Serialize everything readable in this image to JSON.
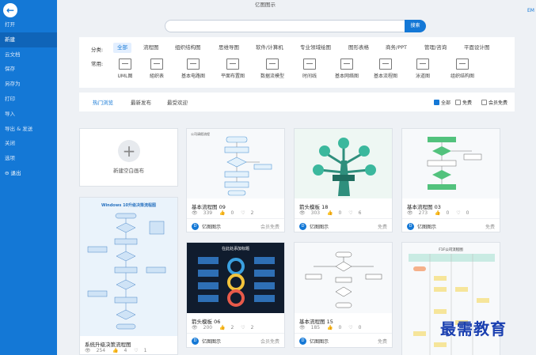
{
  "app": {
    "title": "亿图图示",
    "corner_text": "EM"
  },
  "sidebar": {
    "items": [
      {
        "label": "打开"
      },
      {
        "label": "新建"
      },
      {
        "label": "云文档"
      },
      {
        "label": "保存"
      },
      {
        "label": "另存为"
      },
      {
        "label": "打印"
      },
      {
        "label": "导入"
      },
      {
        "label": "导出 & 发送"
      },
      {
        "label": "关闭"
      },
      {
        "label": "选项"
      },
      {
        "label": "退出"
      }
    ]
  },
  "search": {
    "value": "",
    "button": "搜索"
  },
  "categories": {
    "label": "分类:",
    "items": [
      "全部",
      "流程图",
      "组织结构图",
      "思维导图",
      "软件/计算机",
      "专业领域绘图",
      "图形表格",
      "商务/PPT",
      "管理/咨询",
      "平面设计图"
    ]
  },
  "common": {
    "label": "常用:",
    "items": [
      "UML图",
      "組织表",
      "基本电路图",
      "平面布置图",
      "数据流模型",
      "时间线",
      "基本网络图",
      "基本流程图",
      "泳道图",
      "组织结构图"
    ]
  },
  "sort": {
    "tabs": [
      "热门浏览",
      "最新发布",
      "最受欢迎"
    ],
    "filters": [
      "全部",
      "免费",
      "会员免费"
    ]
  },
  "new_blank": {
    "label": "新建空白画布"
  },
  "cards": [
    {
      "title": "基本流程图 09",
      "views": "339",
      "likes": "0",
      "hearts": "2",
      "brand": "亿图图示",
      "tag": "会员免费",
      "thumb_title": "公司请假流程"
    },
    {
      "title": "箭头模板 18",
      "views": "303",
      "likes": "0",
      "hearts": "6",
      "brand": "亿图图示",
      "tag": "免费",
      "thumb_title": ""
    },
    {
      "title": "基本流程图 03",
      "views": "273",
      "likes": "0",
      "hearts": "0",
      "brand": "亿图图示",
      "tag": "免费",
      "thumb_title": ""
    },
    {
      "title": "系统升级决策流程图",
      "views": "254",
      "likes": "4",
      "hearts": "1",
      "brand": "",
      "tag": "",
      "thumb_title": "Windows 10升级决策流程图"
    },
    {
      "title": "箭头模板 06",
      "views": "200",
      "likes": "2",
      "hearts": "2",
      "brand": "亿图图示",
      "tag": "会员免费",
      "thumb_title": "在此处添加标题"
    },
    {
      "title": "基本流程图 15",
      "views": "185",
      "likes": "0",
      "hearts": "0",
      "brand": "亿图图示",
      "tag": "免费",
      "thumb_title": ""
    },
    {
      "title": "",
      "views": "",
      "likes": "",
      "hearts": "",
      "brand": "",
      "tag": "",
      "thumb_title": "F1F公司流程图"
    }
  ],
  "watermark": "最需教育",
  "colors": {
    "accent": "#1478d6",
    "sidebar": "#1478d6",
    "background": "#eef1f5"
  }
}
